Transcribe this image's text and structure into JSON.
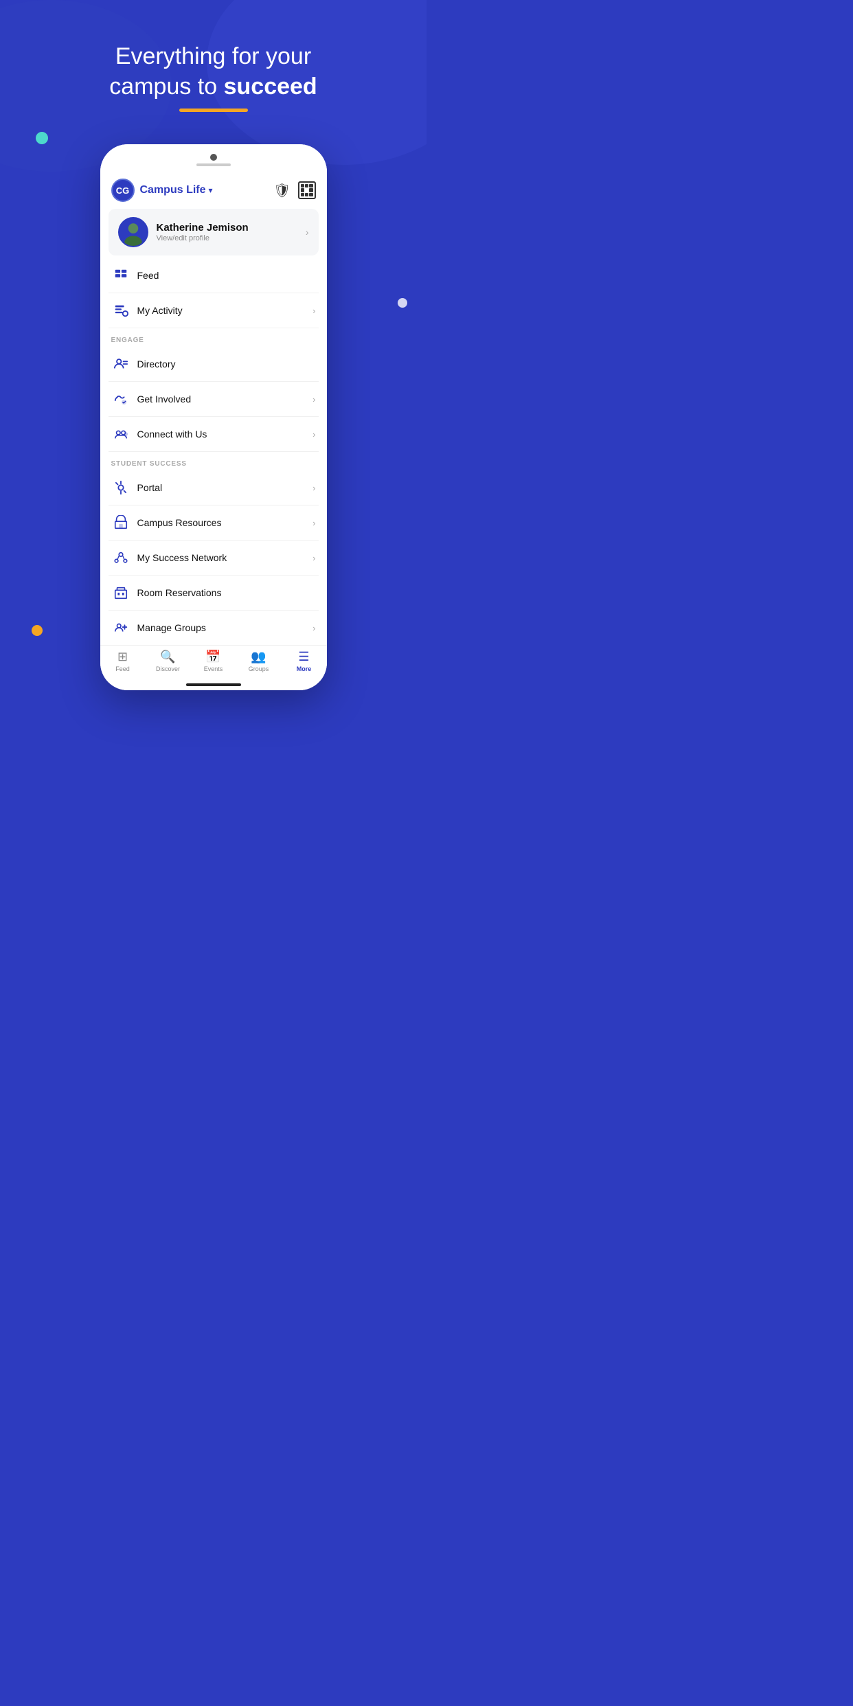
{
  "background": {
    "primaryColor": "#2d3bbf",
    "accentColor": "#f5a623",
    "tealDot": "#4dd9cc"
  },
  "header": {
    "line1": "Everything for your",
    "line2_prefix": "campus to ",
    "line2_bold": "succeed"
  },
  "app": {
    "logoText": "CG",
    "appName": "Campus Life",
    "chevron": "▾"
  },
  "profile": {
    "name": "Katherine Jemison",
    "subtext": "View/edit profile"
  },
  "menu": {
    "feedLabel": "Feed",
    "myActivityLabel": "My Activity",
    "engageSectionLabel": "ENGAGE",
    "directoryLabel": "Directory",
    "getInvolvedLabel": "Get Involved",
    "connectWithUsLabel": "Connect with Us",
    "studentSuccessSectionLabel": "STUDENT SUCCESS",
    "portalLabel": "Portal",
    "campusResourcesLabel": "Campus Resources",
    "mySuccessNetworkLabel": "My Success Network",
    "roomReservationsLabel": "Room Reservations",
    "manageGroupsLabel": "Manage Groups"
  },
  "bottomNav": {
    "items": [
      {
        "label": "Feed",
        "active": false
      },
      {
        "label": "Discover",
        "active": false
      },
      {
        "label": "Events",
        "active": false
      },
      {
        "label": "Groups",
        "active": false
      },
      {
        "label": "More",
        "active": true
      }
    ]
  }
}
